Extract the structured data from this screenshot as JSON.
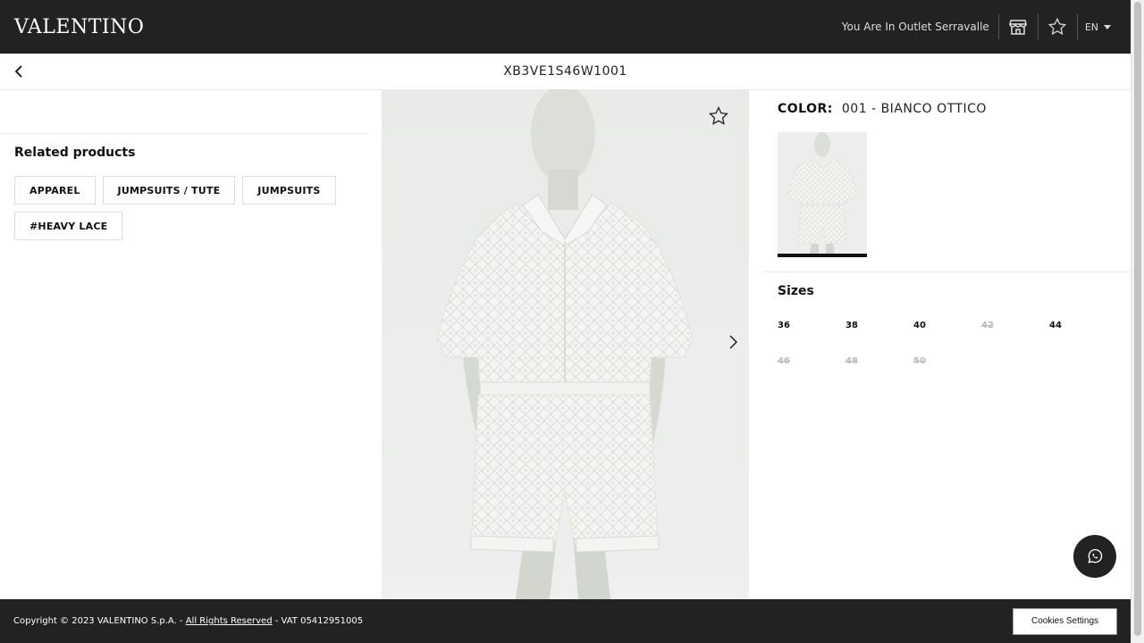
{
  "header": {
    "logo": "VALENTINO",
    "outlet_text": "You Are In Outlet Serravalle",
    "language": "EN",
    "icons": [
      "store-icon",
      "star-icon",
      "chevron-down-icon"
    ],
    "background": "#222222"
  },
  "subheader": {
    "product_code": "XB3VE1S46W1001",
    "back_icon": "chevron-left-icon"
  },
  "related": {
    "title": "Related products",
    "tags": [
      "APPAREL",
      "JUMPSUITS / TUTE",
      "JUMPSUITS",
      "#HEAVY LACE"
    ]
  },
  "gallery": {
    "favorite_icon": "star-icon",
    "next_icon": "chevron-right-icon"
  },
  "product": {
    "color_label": "COLOR:",
    "color_value": "001 - BIANCO OTTICO",
    "sizes_title": "Sizes",
    "sizes": [
      {
        "label": "36",
        "available": true
      },
      {
        "label": "38",
        "available": true
      },
      {
        "label": "40",
        "available": true
      },
      {
        "label": "42",
        "available": false
      },
      {
        "label": "44",
        "available": true
      },
      {
        "label": "46",
        "available": false
      },
      {
        "label": "48",
        "available": false
      },
      {
        "label": "50",
        "available": false
      }
    ]
  },
  "chat": {
    "icon": "whatsapp-icon"
  },
  "footer": {
    "copyright_prefix": "Copyright © 2023 VALENTINO S.p.A. - ",
    "rights_link": "All Rights Reserved",
    "vat": " - VAT 05412951005",
    "cookies_button": "Cookies Settings"
  }
}
